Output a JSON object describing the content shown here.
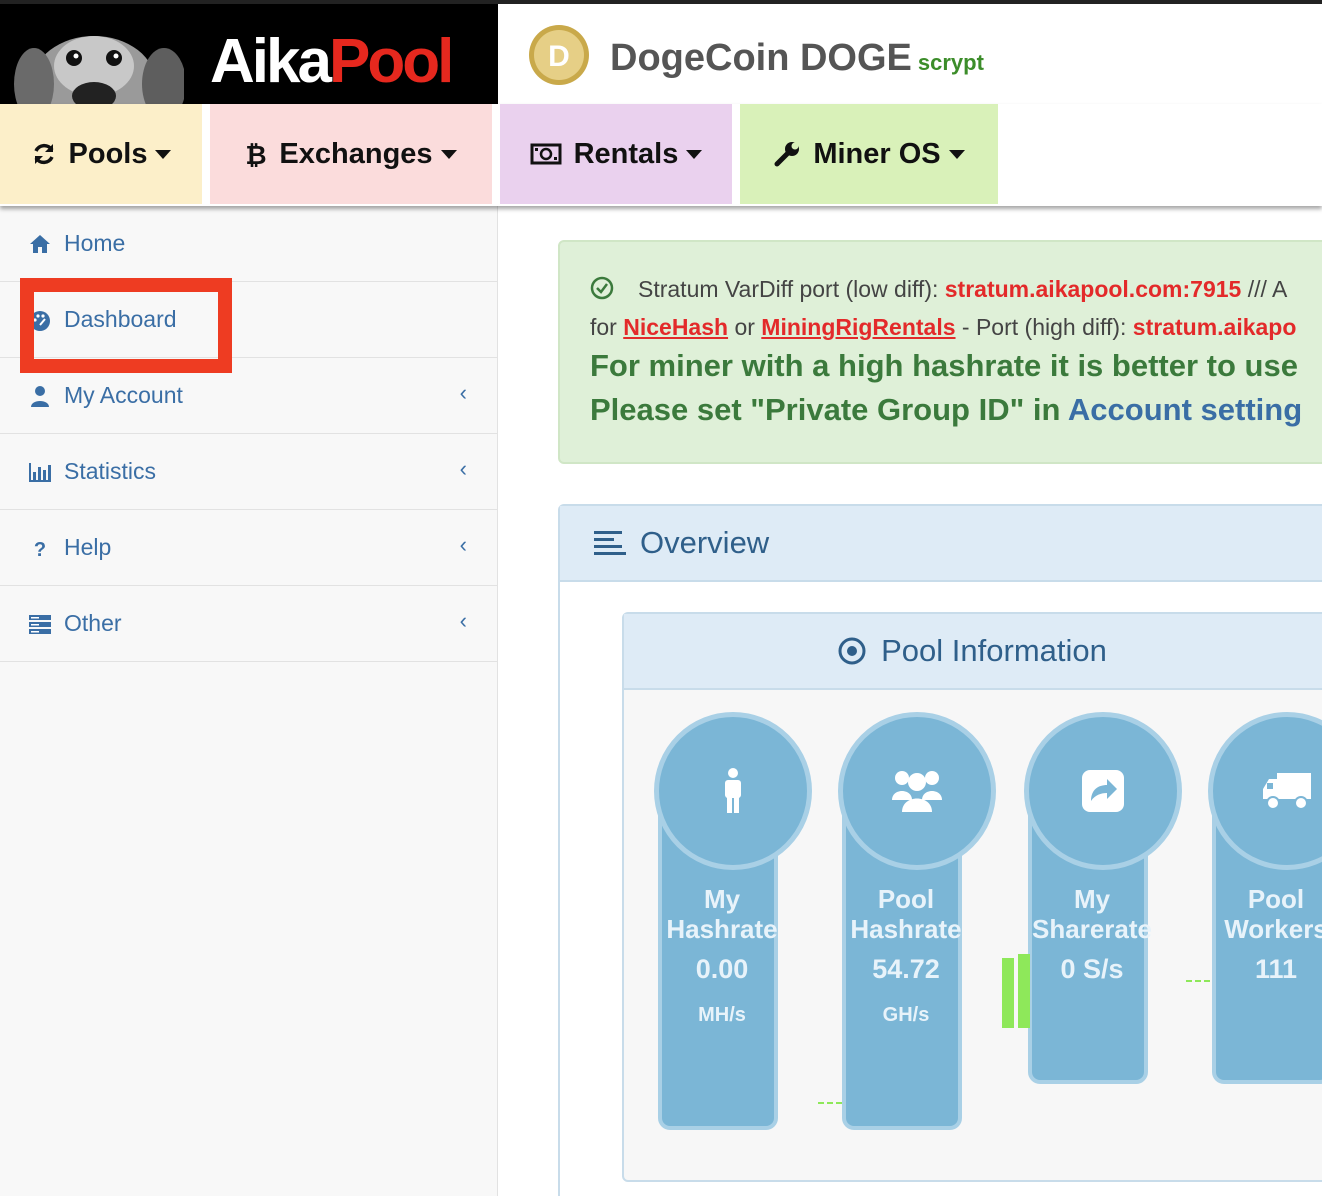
{
  "brand": {
    "part1": "Aika",
    "part2": "Pool"
  },
  "coin": {
    "name": "DogeCoin DOGE",
    "algo": "scrypt",
    "logo_letter": "D"
  },
  "nav": [
    {
      "label": "Pools",
      "icon": "refresh-icon"
    },
    {
      "label": "Exchanges",
      "icon": "bitcoin-icon"
    },
    {
      "label": "Rentals",
      "icon": "money-icon"
    },
    {
      "label": "Miner OS",
      "icon": "wrench-icon"
    }
  ],
  "sidebar": {
    "items": [
      {
        "label": "Home",
        "icon": "home-icon"
      },
      {
        "label": "Dashboard",
        "icon": "dashboard-icon"
      },
      {
        "label": "My Account",
        "icon": "user-icon"
      },
      {
        "label": "Statistics",
        "icon": "bar-chart-icon"
      },
      {
        "label": "Help",
        "icon": "question-icon"
      },
      {
        "label": "Other",
        "icon": "server-icon"
      }
    ],
    "chevron": "‹"
  },
  "alert": {
    "l1_text": "Stratum VarDiff port (low diff): ",
    "l1_addr": "stratum.aikapool.com:7915",
    "l1_tail": " /// A",
    "l2_pre": "for ",
    "l2_nicehash": "NiceHash",
    "l2_or": " or ",
    "l2_mrr": "MiningRigRentals",
    "l2_mid": " - Port (high diff): ",
    "l2_addr": "stratum.aikapo",
    "l3": "For miner with a high hashrate it is better to use",
    "l4_pre": "Please set \"Private Group ID\" in ",
    "l4_link": "Account setting"
  },
  "overview": {
    "title": "Overview"
  },
  "pool_info": {
    "title": "Pool Information",
    "stats": [
      {
        "line1": "My",
        "line2": "Hashrate",
        "value": "0.00",
        "unit": "MH/s",
        "icon": "person-icon"
      },
      {
        "line1": "Pool",
        "line2": "Hashrate",
        "value": "54.72",
        "unit": "GH/s",
        "icon": "users-icon"
      },
      {
        "line1": "My",
        "line2": "Sharerate",
        "value": "0 S/s",
        "unit": "",
        "icon": "share-icon"
      },
      {
        "line1": "Pool",
        "line2": "Workers",
        "value": "111",
        "unit": "",
        "icon": "truck-icon"
      }
    ]
  }
}
